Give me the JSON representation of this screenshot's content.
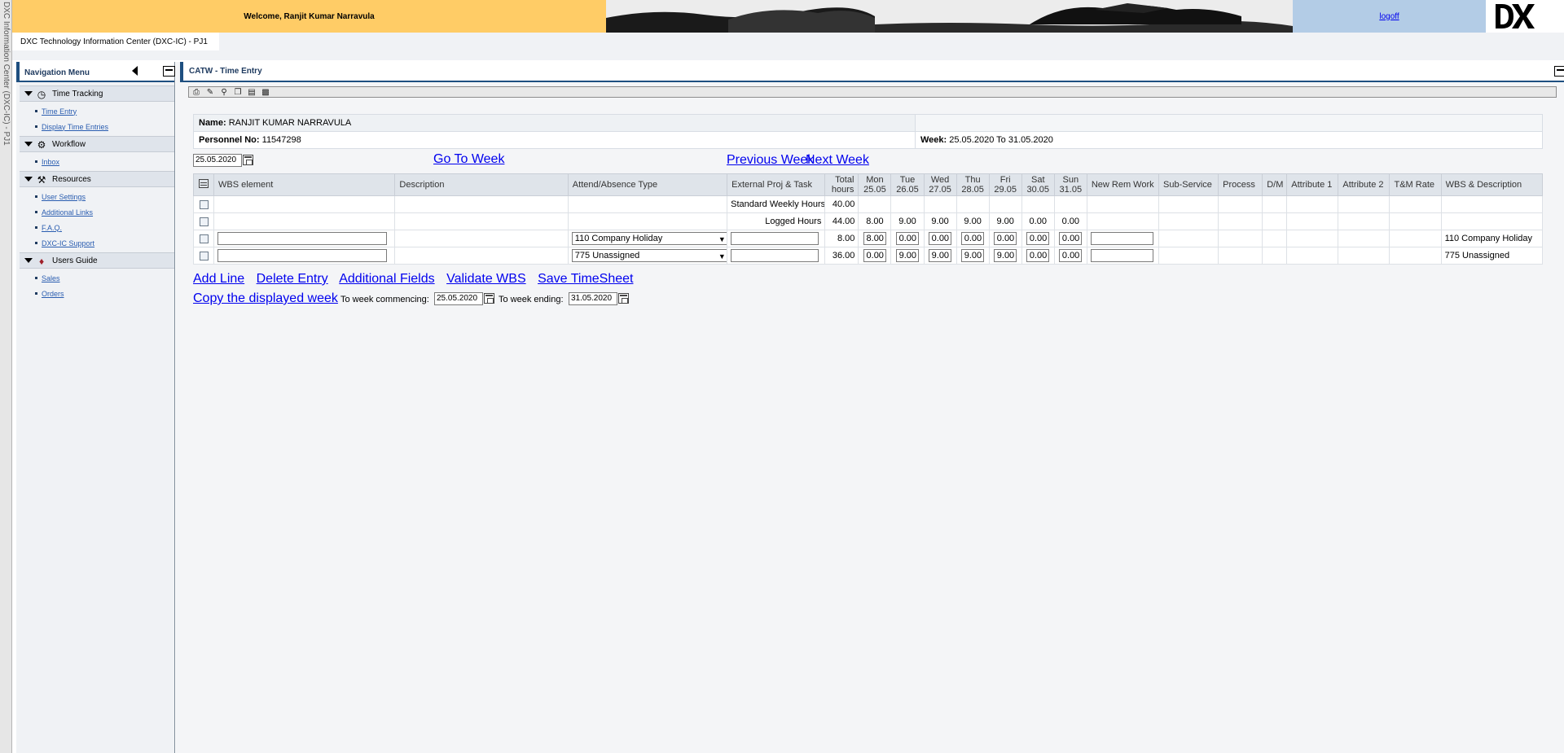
{
  "app": {
    "vertical_title": "DXC Information Center (DXC-IC) - PJ1",
    "welcome": "Welcome, Ranjit Kumar Narravula",
    "logoff": "logoff",
    "info_title": "DXC Technology Information Center (DXC-IC) - PJ1"
  },
  "nav": {
    "title": "Navigation Menu",
    "groups": [
      {
        "label": "Time Tracking",
        "icon": "clock-icon",
        "items": [
          "Time Entry",
          "Display Time Entries"
        ]
      },
      {
        "label": "Workflow",
        "icon": "workflow-icon",
        "items": [
          "Inbox"
        ]
      },
      {
        "label": "Resources",
        "icon": "resources-icon",
        "items": [
          "User Settings",
          "Additional Links",
          "F.A.Q.",
          "DXC-IC Support"
        ]
      },
      {
        "label": "Users Guide",
        "icon": "book-icon",
        "items": [
          "Sales",
          "Orders"
        ]
      }
    ]
  },
  "main": {
    "title": "CATW - Time Entry",
    "employee": {
      "name_label": "Name:",
      "name_value": "RANJIT KUMAR NARRAVULA",
      "pn_label": "Personnel No:",
      "pn_value": "11547298",
      "week_label": "Week:",
      "week_value": "25.05.2020 To 31.05.2020"
    },
    "date_input": "25.05.2020",
    "go_to_week": "Go To Week",
    "previous_week": "Previous Week",
    "next_week": "Next Week",
    "columns": {
      "wbs": "WBS element",
      "desc": "Description",
      "attend": "Attend/Absence Type",
      "ext": "External Proj & Task",
      "total": "Total hours",
      "mon": "Mon 25.05",
      "tue": "Tue 26.05",
      "wed": "Wed 27.05",
      "thu": "Thu 28.05",
      "fri": "Fri 29.05",
      "sat": "Sat 30.05",
      "sun": "Sun 31.05",
      "newrem": "New Rem Work",
      "subservice": "Sub-Service",
      "process": "Process",
      "dm": "D/M",
      "attr1": "Attribute 1",
      "attr2": "Attribute 2",
      "tm": "T&M Rate",
      "wbsdesc": "WBS & Description"
    },
    "standard_row": {
      "label": "Standard Weekly Hours",
      "total": "40.00"
    },
    "logged_row": {
      "label": "Logged Hours",
      "total": "44.00",
      "days": [
        "8.00",
        "9.00",
        "9.00",
        "9.00",
        "9.00",
        "0.00",
        "0.00"
      ]
    },
    "entries": [
      {
        "attend": "110 Company Holiday",
        "total": "8.00",
        "days": [
          "8.00",
          "0.00",
          "0.00",
          "0.00",
          "0.00",
          "0.00",
          "0.00"
        ],
        "wbsdesc": "110 Company Holiday"
      },
      {
        "attend": "775 Unassigned",
        "total": "36.00",
        "days": [
          "0.00",
          "9.00",
          "9.00",
          "9.00",
          "9.00",
          "0.00",
          "0.00"
        ],
        "wbsdesc": "775 Unassigned"
      }
    ],
    "actions": [
      "Add Line",
      "Delete Entry",
      "Additional Fields",
      "Validate WBS",
      "Save TimeSheet"
    ],
    "copy": {
      "link": "Copy the displayed week",
      "commencing_label": "To week commencing:",
      "commencing_value": "25.05.2020",
      "ending_label": "To week ending:",
      "ending_value": "31.05.2020"
    }
  }
}
